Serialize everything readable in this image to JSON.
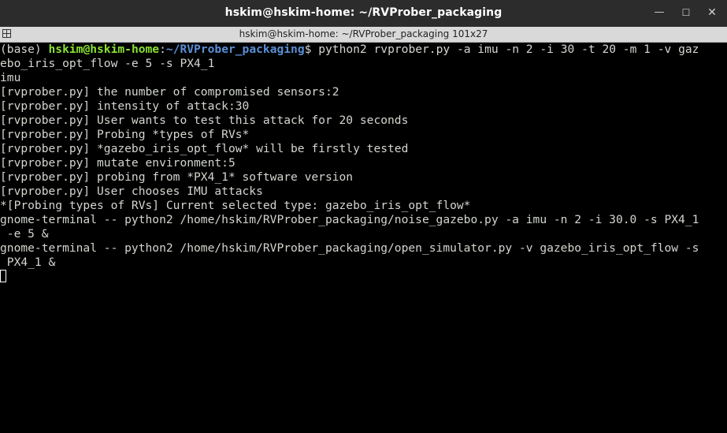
{
  "window": {
    "title": "hskim@hskim-home: ~/RVProber_packaging",
    "minimize_glyph": "—",
    "maximize_glyph": "☐",
    "close_glyph": "✕"
  },
  "tab": {
    "title": "hskim@hskim-home: ~/RVProber_packaging 101x27"
  },
  "terminal": {
    "prompt_prefix": "(base) ",
    "prompt_user": "hskim@hskim-home",
    "prompt_sep": ":",
    "prompt_path": "~/RVProber_packaging",
    "prompt_symbol": "$ ",
    "command": "python2 rvprober.py -a imu -n 2 -i 30 -t 20 -m 1 -v gaz",
    "output": [
      "ebo_iris_opt_flow -e 5 -s PX4_1",
      "imu",
      "[rvprober.py] the number of compromised sensors:2",
      "[rvprober.py] intensity of attack:30",
      "[rvprober.py] User wants to test this attack for 20 seconds",
      "[rvprober.py] Probing *types of RVs*",
      "[rvprober.py] *gazebo_iris_opt_flow* will be firstly tested",
      "[rvprober.py] mutate environment:5",
      "[rvprober.py] probing from *PX4_1* software version",
      "[rvprober.py] User chooses IMU attacks",
      "*[Probing types of RVs] Current selected type: gazebo_iris_opt_flow*",
      "gnome-terminal -- python2 /home/hskim/RVProber_packaging/noise_gazebo.py -a imu -n 2 -i 30.0 -s PX4_1",
      " -e 5 &",
      "gnome-terminal -- python2 /home/hskim/RVProber_packaging/open_simulator.py -v gazebo_iris_opt_flow -s",
      " PX4_1 &"
    ]
  },
  "colors": {
    "titlebar": "#2c2c2c",
    "tabbar": "#d9d9d9",
    "terminal_bg": "#000000",
    "terminal_fg": "#d3d7cf",
    "prompt_user": "#8ae234",
    "prompt_path": "#5a8fd6"
  },
  "icons": {
    "tab_icon": "new-tab-icon",
    "cursor": "block-cursor"
  }
}
